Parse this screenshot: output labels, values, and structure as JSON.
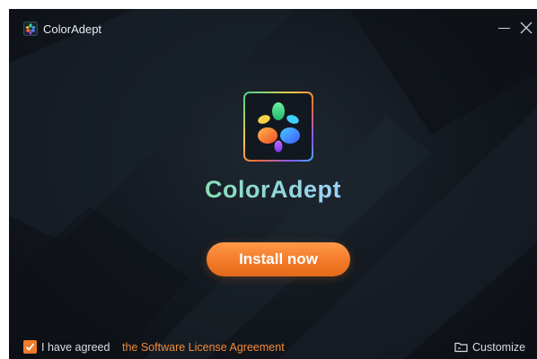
{
  "window": {
    "title": "ColorAdept",
    "minimize_icon": "minimize-icon",
    "close_icon": "close-icon"
  },
  "hero": {
    "brand_name": "ColorAdept",
    "logo_icon": "coloradept-logo-icon"
  },
  "actions": {
    "install_label": "Install now"
  },
  "footer": {
    "agree_checked": true,
    "agree_text": "I have agreed",
    "license_link": "the Software License Agreement",
    "customize_label": "Customize",
    "customize_icon": "folder-icon"
  },
  "colors": {
    "accent_orange": "#f27a28",
    "link_orange": "#f08a3a",
    "background_dark": "#141a21"
  }
}
